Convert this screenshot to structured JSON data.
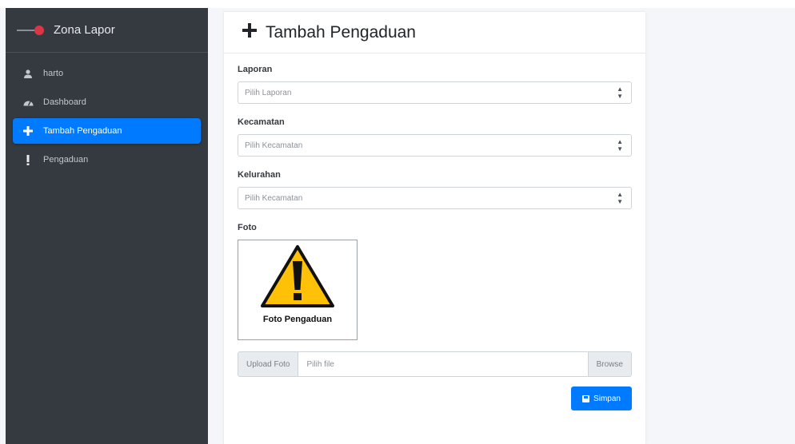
{
  "brand": {
    "name": "Zona Lapor",
    "logo_icon": "logo-icon"
  },
  "sidebar": {
    "items": [
      {
        "label": "harto",
        "icon": "user-icon",
        "active": false
      },
      {
        "label": "Dashboard",
        "icon": "dashboard-icon",
        "active": false
      },
      {
        "label": "Tambah Pengaduan",
        "icon": "plus-icon",
        "active": true
      },
      {
        "label": "Pengaduan",
        "icon": "exclamation-icon",
        "active": false
      }
    ]
  },
  "card": {
    "title": "Tambah Pengaduan",
    "title_icon": "plus-icon"
  },
  "form": {
    "laporan": {
      "label": "Laporan",
      "value": "Pilih Laporan"
    },
    "kecamatan": {
      "label": "Kecamatan",
      "value": "Pilih Kecamatan"
    },
    "kelurahan": {
      "label": "Kelurahan",
      "value": "Pilih Kecamatan"
    },
    "foto": {
      "label": "Foto",
      "caption": "Foto Pengaduan",
      "icon": "warning-icon"
    },
    "upload": {
      "prefix": "Upload Foto",
      "placeholder": "Pilih file",
      "browse": "Browse"
    },
    "submit": {
      "label": "Simpan",
      "icon": "save-icon"
    }
  },
  "colors": {
    "accent": "#007bff",
    "sidebar_bg": "#343a40",
    "warning": "#ffc107",
    "brand_dot": "#dc3545"
  }
}
